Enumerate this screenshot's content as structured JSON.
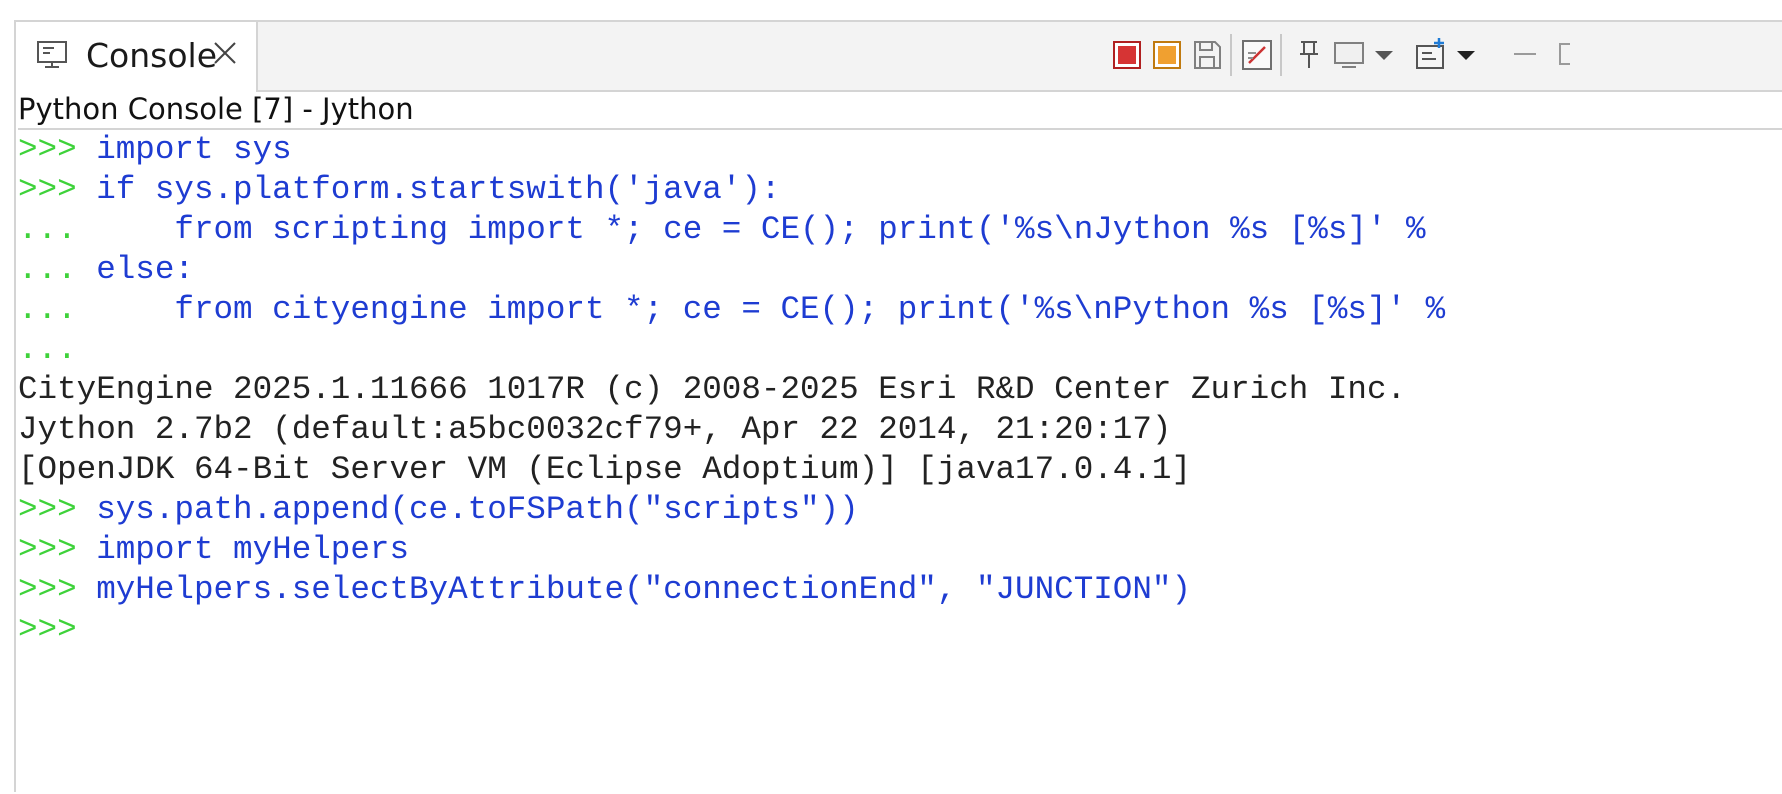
{
  "tab": {
    "label": "Console",
    "icon": "console-icon",
    "close_icon": "close-icon"
  },
  "toolbar": {
    "icons": [
      "terminate-icon",
      "remove-launch-icon",
      "save-icon",
      "clear-console-icon",
      "pin-console-icon",
      "display-selected-console-icon",
      "display-console-dropdown-icon",
      "open-console-icon",
      "open-console-dropdown-icon",
      "minimize-icon",
      "maximize-icon"
    ],
    "colors": {
      "terminate": "#d63434",
      "remove": "#f0a030",
      "icon_gray": "#606060",
      "clear_red": "#cc3333"
    }
  },
  "console": {
    "title": "Python Console [7] - Jython",
    "colors": {
      "prompt": "#3ed23a",
      "input": "#1e3cd2",
      "output": "#222222"
    },
    "lines": [
      {
        "prompt": ">>> ",
        "text": "import sys",
        "kind": "input"
      },
      {
        "prompt": ">>> ",
        "text": "if sys.platform.startswith('java'):",
        "kind": "input"
      },
      {
        "prompt": "... ",
        "text": "    from scripting import *; ce = CE(); print('%s\\nJython %s [%s]' %",
        "kind": "input"
      },
      {
        "prompt": "... ",
        "text": "else:",
        "kind": "input"
      },
      {
        "prompt": "... ",
        "text": "    from cityengine import *; ce = CE(); print('%s\\nPython %s [%s]' %",
        "kind": "input"
      },
      {
        "prompt": "...",
        "text": "",
        "kind": "input"
      },
      {
        "prompt": "",
        "text": "CityEngine 2025.1.11666 1017R (c) 2008-2025 Esri R&D Center Zurich Inc.",
        "kind": "output"
      },
      {
        "prompt": "",
        "text": "Jython 2.7b2 (default:a5bc0032cf79+, Apr 22 2014, 21:20:17)",
        "kind": "output"
      },
      {
        "prompt": "",
        "text": "[OpenJDK 64-Bit Server VM (Eclipse Adoptium)] [java17.0.4.1]",
        "kind": "output"
      },
      {
        "prompt": ">>> ",
        "text": "sys.path.append(ce.toFSPath(\"scripts\"))",
        "kind": "input"
      },
      {
        "prompt": ">>> ",
        "text": "import myHelpers",
        "kind": "input"
      },
      {
        "prompt": ">>> ",
        "text": "myHelpers.selectByAttribute(\"connectionEnd\", \"JUNCTION\")",
        "kind": "input"
      },
      {
        "prompt": ">>>",
        "text": "",
        "kind": "input"
      }
    ]
  }
}
